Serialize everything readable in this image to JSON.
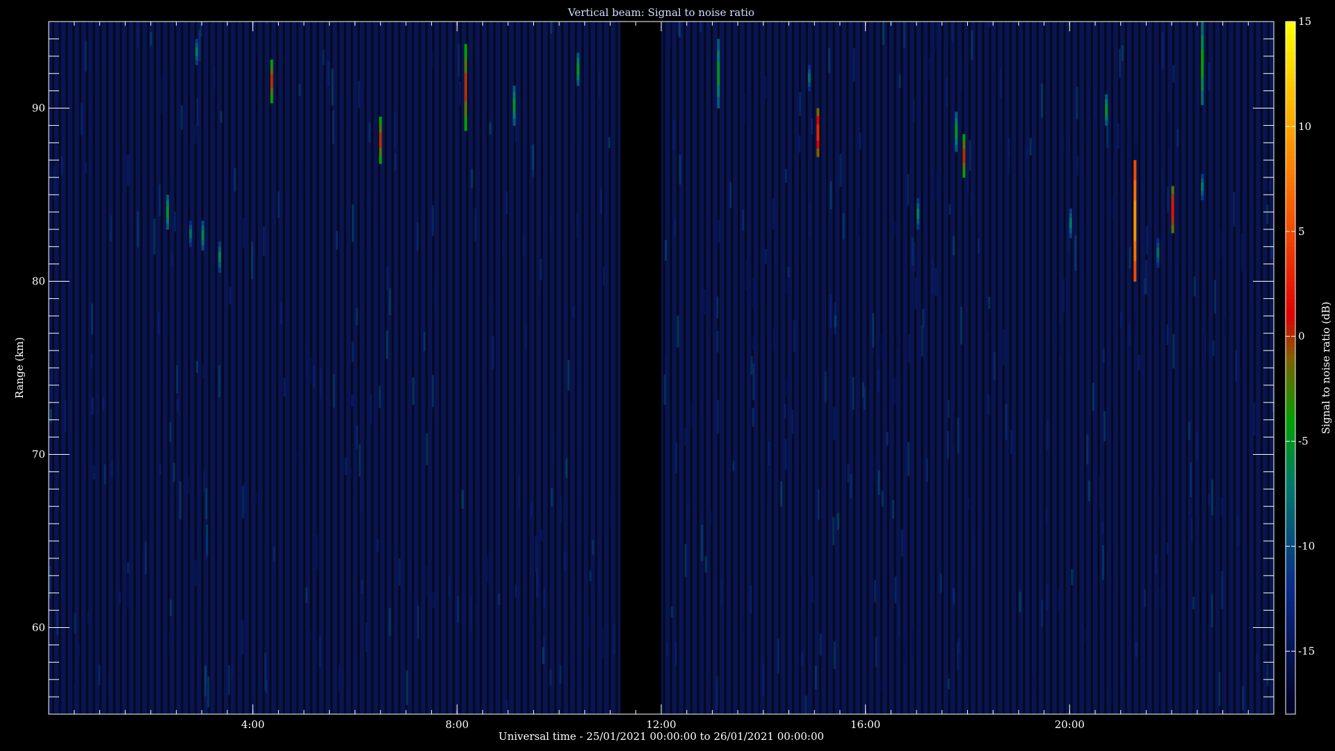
{
  "chart_data": {
    "type": "heatmap",
    "title": "Vertical beam: Signal to noise ratio",
    "xlabel": "Universal time - 25/01/2021 00:00:00 to 26/01/2021 00:00:00",
    "ylabel": "Range (km)",
    "colorbar_label": "Signal to noise ratio (dB)",
    "xlim_hours": [
      0,
      24
    ],
    "ylim_km": [
      55,
      95
    ],
    "x_ticks": [
      {
        "hours": 4,
        "label": "4:00"
      },
      {
        "hours": 8,
        "label": "8:00"
      },
      {
        "hours": 12,
        "label": "12:00"
      },
      {
        "hours": 16,
        "label": "16:00"
      },
      {
        "hours": 20,
        "label": "20:00"
      }
    ],
    "y_ticks": [
      {
        "km": 60,
        "label": "60"
      },
      {
        "km": 70,
        "label": "70"
      },
      {
        "km": 80,
        "label": "80"
      },
      {
        "km": 90,
        "label": "90"
      }
    ],
    "colorbar": {
      "range_db": [
        -18,
        15
      ],
      "ticks": [
        {
          "db": -15,
          "label": "-15"
        },
        {
          "db": -10,
          "label": "-10"
        },
        {
          "db": -5,
          "label": "-5"
        },
        {
          "db": 0,
          "label": "0"
        },
        {
          "db": 5,
          "label": "5"
        },
        {
          "db": 10,
          "label": "10"
        },
        {
          "db": 15,
          "label": "15"
        }
      ],
      "color_stops": [
        {
          "db": -18,
          "color": "#000020"
        },
        {
          "db": -12,
          "color": "#0a2a8a"
        },
        {
          "db": -7,
          "color": "#007a6a"
        },
        {
          "db": -4,
          "color": "#00a000"
        },
        {
          "db": -1,
          "color": "#806000"
        },
        {
          "db": 1,
          "color": "#e00000"
        },
        {
          "db": 8,
          "color": "#ff8000"
        },
        {
          "db": 15,
          "color": "#ffff00"
        }
      ]
    },
    "background_color": "#0a1450",
    "data_gaps_hours": [
      [
        11.2,
        12.0
      ]
    ],
    "echoes": [
      {
        "time": 2.33,
        "range_from": 83.0,
        "range_to": 85.0,
        "snr_db": -4
      },
      {
        "time": 2.78,
        "range_from": 82.0,
        "range_to": 83.5,
        "snr_db": -7
      },
      {
        "time": 2.9,
        "range_from": 92.5,
        "range_to": 94.0,
        "snr_db": -6
      },
      {
        "time": 3.02,
        "range_from": 81.8,
        "range_to": 83.5,
        "snr_db": -5
      },
      {
        "time": 3.35,
        "range_from": 80.5,
        "range_to": 82.3,
        "snr_db": -6
      },
      {
        "time": 4.37,
        "range_from": 90.3,
        "range_to": 92.8,
        "snr_db": 1
      },
      {
        "time": 6.5,
        "range_from": 86.8,
        "range_to": 89.5,
        "snr_db": 1
      },
      {
        "time": 8.17,
        "range_from": 88.7,
        "range_to": 93.7,
        "snr_db": 1
      },
      {
        "time": 9.12,
        "range_from": 89.0,
        "range_to": 91.3,
        "snr_db": -4
      },
      {
        "time": 10.37,
        "range_from": 91.3,
        "range_to": 93.2,
        "snr_db": -4
      },
      {
        "time": 13.12,
        "range_from": 90.0,
        "range_to": 94.0,
        "snr_db": -4
      },
      {
        "time": 14.9,
        "range_from": 91.0,
        "range_to": 92.5,
        "snr_db": -7
      },
      {
        "time": 15.07,
        "range_from": 87.2,
        "range_to": 90.0,
        "snr_db": 4
      },
      {
        "time": 17.03,
        "range_from": 83.0,
        "range_to": 84.8,
        "snr_db": -6
      },
      {
        "time": 17.78,
        "range_from": 87.5,
        "range_to": 89.8,
        "snr_db": -4
      },
      {
        "time": 17.93,
        "range_from": 86.0,
        "range_to": 88.5,
        "snr_db": 1
      },
      {
        "time": 20.02,
        "range_from": 82.5,
        "range_to": 84.2,
        "snr_db": -6
      },
      {
        "time": 20.72,
        "range_from": 89.0,
        "range_to": 90.8,
        "snr_db": -4
      },
      {
        "time": 21.28,
        "range_from": 80.0,
        "range_to": 87.0,
        "snr_db": 10
      },
      {
        "time": 21.73,
        "range_from": 80.8,
        "range_to": 82.5,
        "snr_db": -7
      },
      {
        "time": 22.02,
        "range_from": 82.8,
        "range_to": 85.5,
        "snr_db": 3
      },
      {
        "time": 22.6,
        "range_from": 90.2,
        "range_to": 95.0,
        "snr_db": -3
      },
      {
        "time": 22.6,
        "range_from": 84.7,
        "range_to": 86.2,
        "snr_db": -6
      }
    ]
  }
}
